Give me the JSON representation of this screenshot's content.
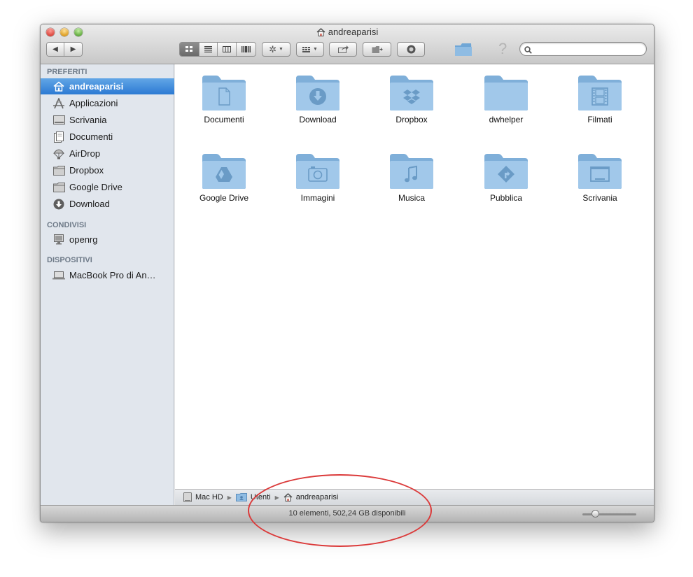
{
  "window": {
    "title": "andreaparisi"
  },
  "toolbar": {
    "back_icon": "chevron-left-icon",
    "forward_icon": "chevron-right-icon",
    "view_modes": [
      "icon-view-icon",
      "list-view-icon",
      "column-view-icon",
      "coverflow-view-icon"
    ],
    "actions_icon": "gear-icon",
    "arrange_icon": "arrange-grid-icon",
    "share_icon": "share-icon",
    "new_folder_icon": "new-folder-icon",
    "quicklook_icon": "quicklook-icon",
    "search": {
      "placeholder": "",
      "value": ""
    }
  },
  "sidebar": {
    "favorites": {
      "header": "PREFERITI",
      "items": [
        {
          "label": "andreaparisi",
          "icon": "home-icon",
          "selected": true
        },
        {
          "label": "Applicazioni",
          "icon": "applications-icon"
        },
        {
          "label": "Scrivania",
          "icon": "desktop-icon"
        },
        {
          "label": "Documenti",
          "icon": "documents-icon"
        },
        {
          "label": "AirDrop",
          "icon": "airdrop-icon"
        },
        {
          "label": "Dropbox",
          "icon": "folder-icon"
        },
        {
          "label": "Google Drive",
          "icon": "folder-icon"
        },
        {
          "label": "Download",
          "icon": "download-icon"
        }
      ]
    },
    "shared": {
      "header": "CONDIVISI",
      "items": [
        {
          "label": "openrg",
          "icon": "monitor-icon"
        }
      ]
    },
    "devices": {
      "header": "DISPOSITIVI",
      "items": [
        {
          "label": "MacBook Pro di An…",
          "icon": "laptop-icon"
        }
      ]
    }
  },
  "content": {
    "items": [
      {
        "label": "Documenti",
        "glyph": "document"
      },
      {
        "label": "Download",
        "glyph": "download"
      },
      {
        "label": "Dropbox",
        "glyph": "dropbox"
      },
      {
        "label": "dwhelper",
        "glyph": "none"
      },
      {
        "label": "Filmati",
        "glyph": "film"
      },
      {
        "label": "Google Drive",
        "glyph": "drive"
      },
      {
        "label": "Immagini",
        "glyph": "camera"
      },
      {
        "label": "Musica",
        "glyph": "music"
      },
      {
        "label": "Pubblica",
        "glyph": "public"
      },
      {
        "label": "Scrivania",
        "glyph": "desktop"
      }
    ]
  },
  "pathbar": {
    "crumbs": [
      "Mac HD",
      "Utenti",
      "andreaparisi"
    ]
  },
  "statusbar": {
    "text": "10 elementi, 502,24 GB disponibili",
    "zoom_level": 0.2
  },
  "colors": {
    "selection": "#2c7ad3",
    "folder": "#8fb8dc",
    "annotation": "#db3a3a"
  }
}
